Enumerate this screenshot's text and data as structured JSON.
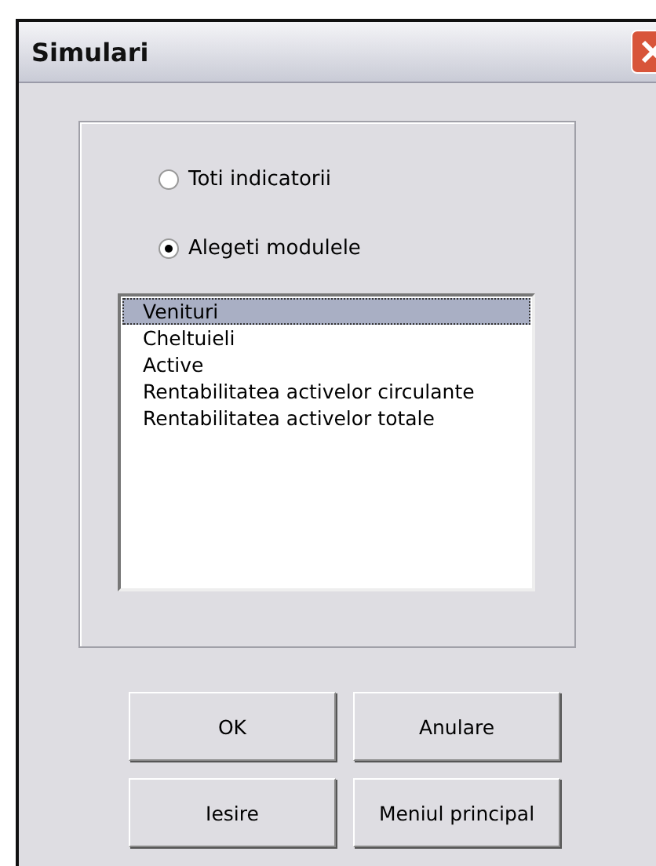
{
  "window": {
    "title": "Simulari"
  },
  "options": [
    {
      "label": "Toti indicatorii",
      "selected": false
    },
    {
      "label": "Alegeti modulele",
      "selected": true
    }
  ],
  "modules": [
    {
      "label": "Venituri",
      "selected": true
    },
    {
      "label": "Cheltuieli",
      "selected": false
    },
    {
      "label": "Active",
      "selected": false
    },
    {
      "label": "Rentabilitatea activelor circulante",
      "selected": false
    },
    {
      "label": "Rentabilitatea activelor totale",
      "selected": false
    }
  ],
  "buttons": [
    "OK",
    "Anulare",
    "Iesire",
    "Meniul principal"
  ]
}
